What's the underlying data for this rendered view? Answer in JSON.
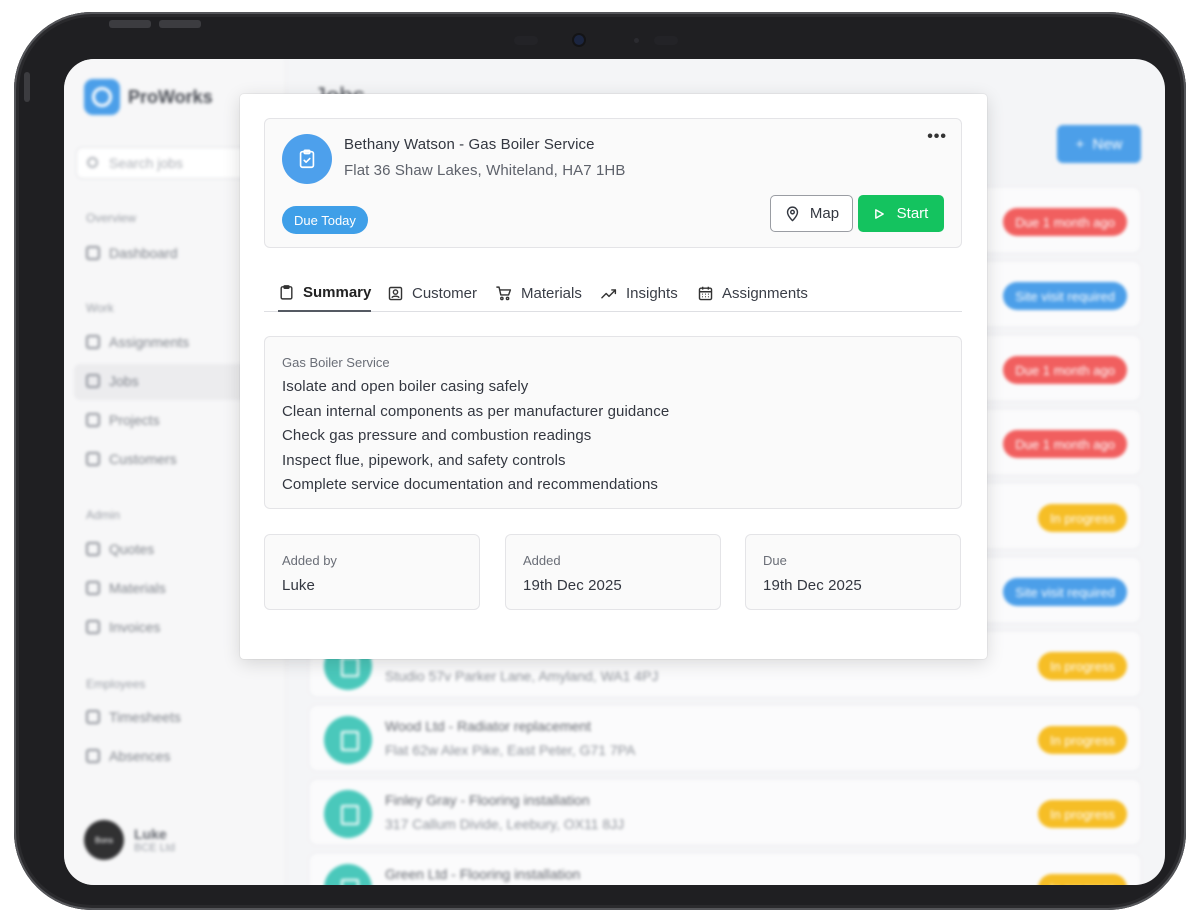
{
  "app": {
    "brand": "ProWorks",
    "page_title": "Jobs",
    "new_button": "New",
    "search_placeholder": "Search jobs",
    "sidebar": {
      "sections": [
        {
          "label": "Overview",
          "items": [
            "Dashboard"
          ]
        },
        {
          "label": "Work",
          "items": [
            "Assignments",
            "Jobs",
            "Projects",
            "Customers"
          ]
        },
        {
          "label": "Admin",
          "items": [
            "Quotes",
            "Materials",
            "Invoices"
          ]
        },
        {
          "label": "Employees",
          "items": [
            "Timesheets",
            "Absences"
          ]
        }
      ],
      "active_item": "Jobs"
    },
    "user": {
      "name": "Luke",
      "company": "BCE Ltd",
      "avatar_text": "Bons"
    },
    "job_list": [
      {
        "title": "",
        "address": "",
        "badge": "Due 1 month ago",
        "badge_color": "#ef4444"
      },
      {
        "title": "",
        "address": "",
        "badge": "Site visit required",
        "badge_color": "#2d8fe6"
      },
      {
        "title": "",
        "address": "",
        "badge": "Due 1 month ago",
        "badge_color": "#ef4444"
      },
      {
        "title": "",
        "address": "",
        "badge": "Due 1 month ago",
        "badge_color": "#ef4444"
      },
      {
        "title": "",
        "address": "",
        "badge": "In progress",
        "badge_color": "#f5b301"
      },
      {
        "title": "",
        "address": "",
        "badge": "Site visit required",
        "badge_color": "#2d8fe6"
      },
      {
        "title": "",
        "address": "Studio 57v Parker Lane, Amyland, WA1 4PJ",
        "badge": "In progress",
        "badge_color": "#f5b301"
      },
      {
        "title": "Wood Ltd - Radiator replacement",
        "address": "Flat 62w Alex Pike, East Peter, G71 7PA",
        "badge": "In progress",
        "badge_color": "#f5b301"
      },
      {
        "title": "Finley Gray - Flooring installation",
        "address": "317 Callum Divide, Leebury, OX11 8JJ",
        "badge": "In progress",
        "badge_color": "#f5b301"
      },
      {
        "title": "Green Ltd - Flooring installation",
        "address": "",
        "badge": "In progress",
        "badge_color": "#f5b301"
      }
    ]
  },
  "modal": {
    "job_title": "Bethany Watson - Gas Boiler Service",
    "job_address": "Flat 36 Shaw Lakes, Whiteland, HA7 1HB",
    "more_label": "•••",
    "status_badge": "Due Today",
    "map_button": "Map",
    "start_button": "Start",
    "tabs": [
      "Summary",
      "Customer",
      "Materials",
      "Insights",
      "Assignments"
    ],
    "active_tab": "Summary",
    "summary": {
      "heading": "Gas Boiler Service",
      "tasks": [
        "Isolate and open boiler casing safely",
        "Clean internal components as per manufacturer guidance",
        "Check gas pressure and combustion readings",
        "Inspect flue, pipework, and safety controls",
        "Complete service documentation and recommendations"
      ]
    },
    "info": [
      {
        "label": "Added by",
        "value": "Luke"
      },
      {
        "label": "Added",
        "value": "19th Dec 2025"
      },
      {
        "label": "Due",
        "value": "19th Dec 2025"
      }
    ]
  },
  "colors": {
    "accent": "#2d8fe6",
    "avatar": "#4da0ec",
    "start": "#14c35f",
    "due_badge": "#3f9fe8",
    "job_icon": "#2bbfb0"
  }
}
